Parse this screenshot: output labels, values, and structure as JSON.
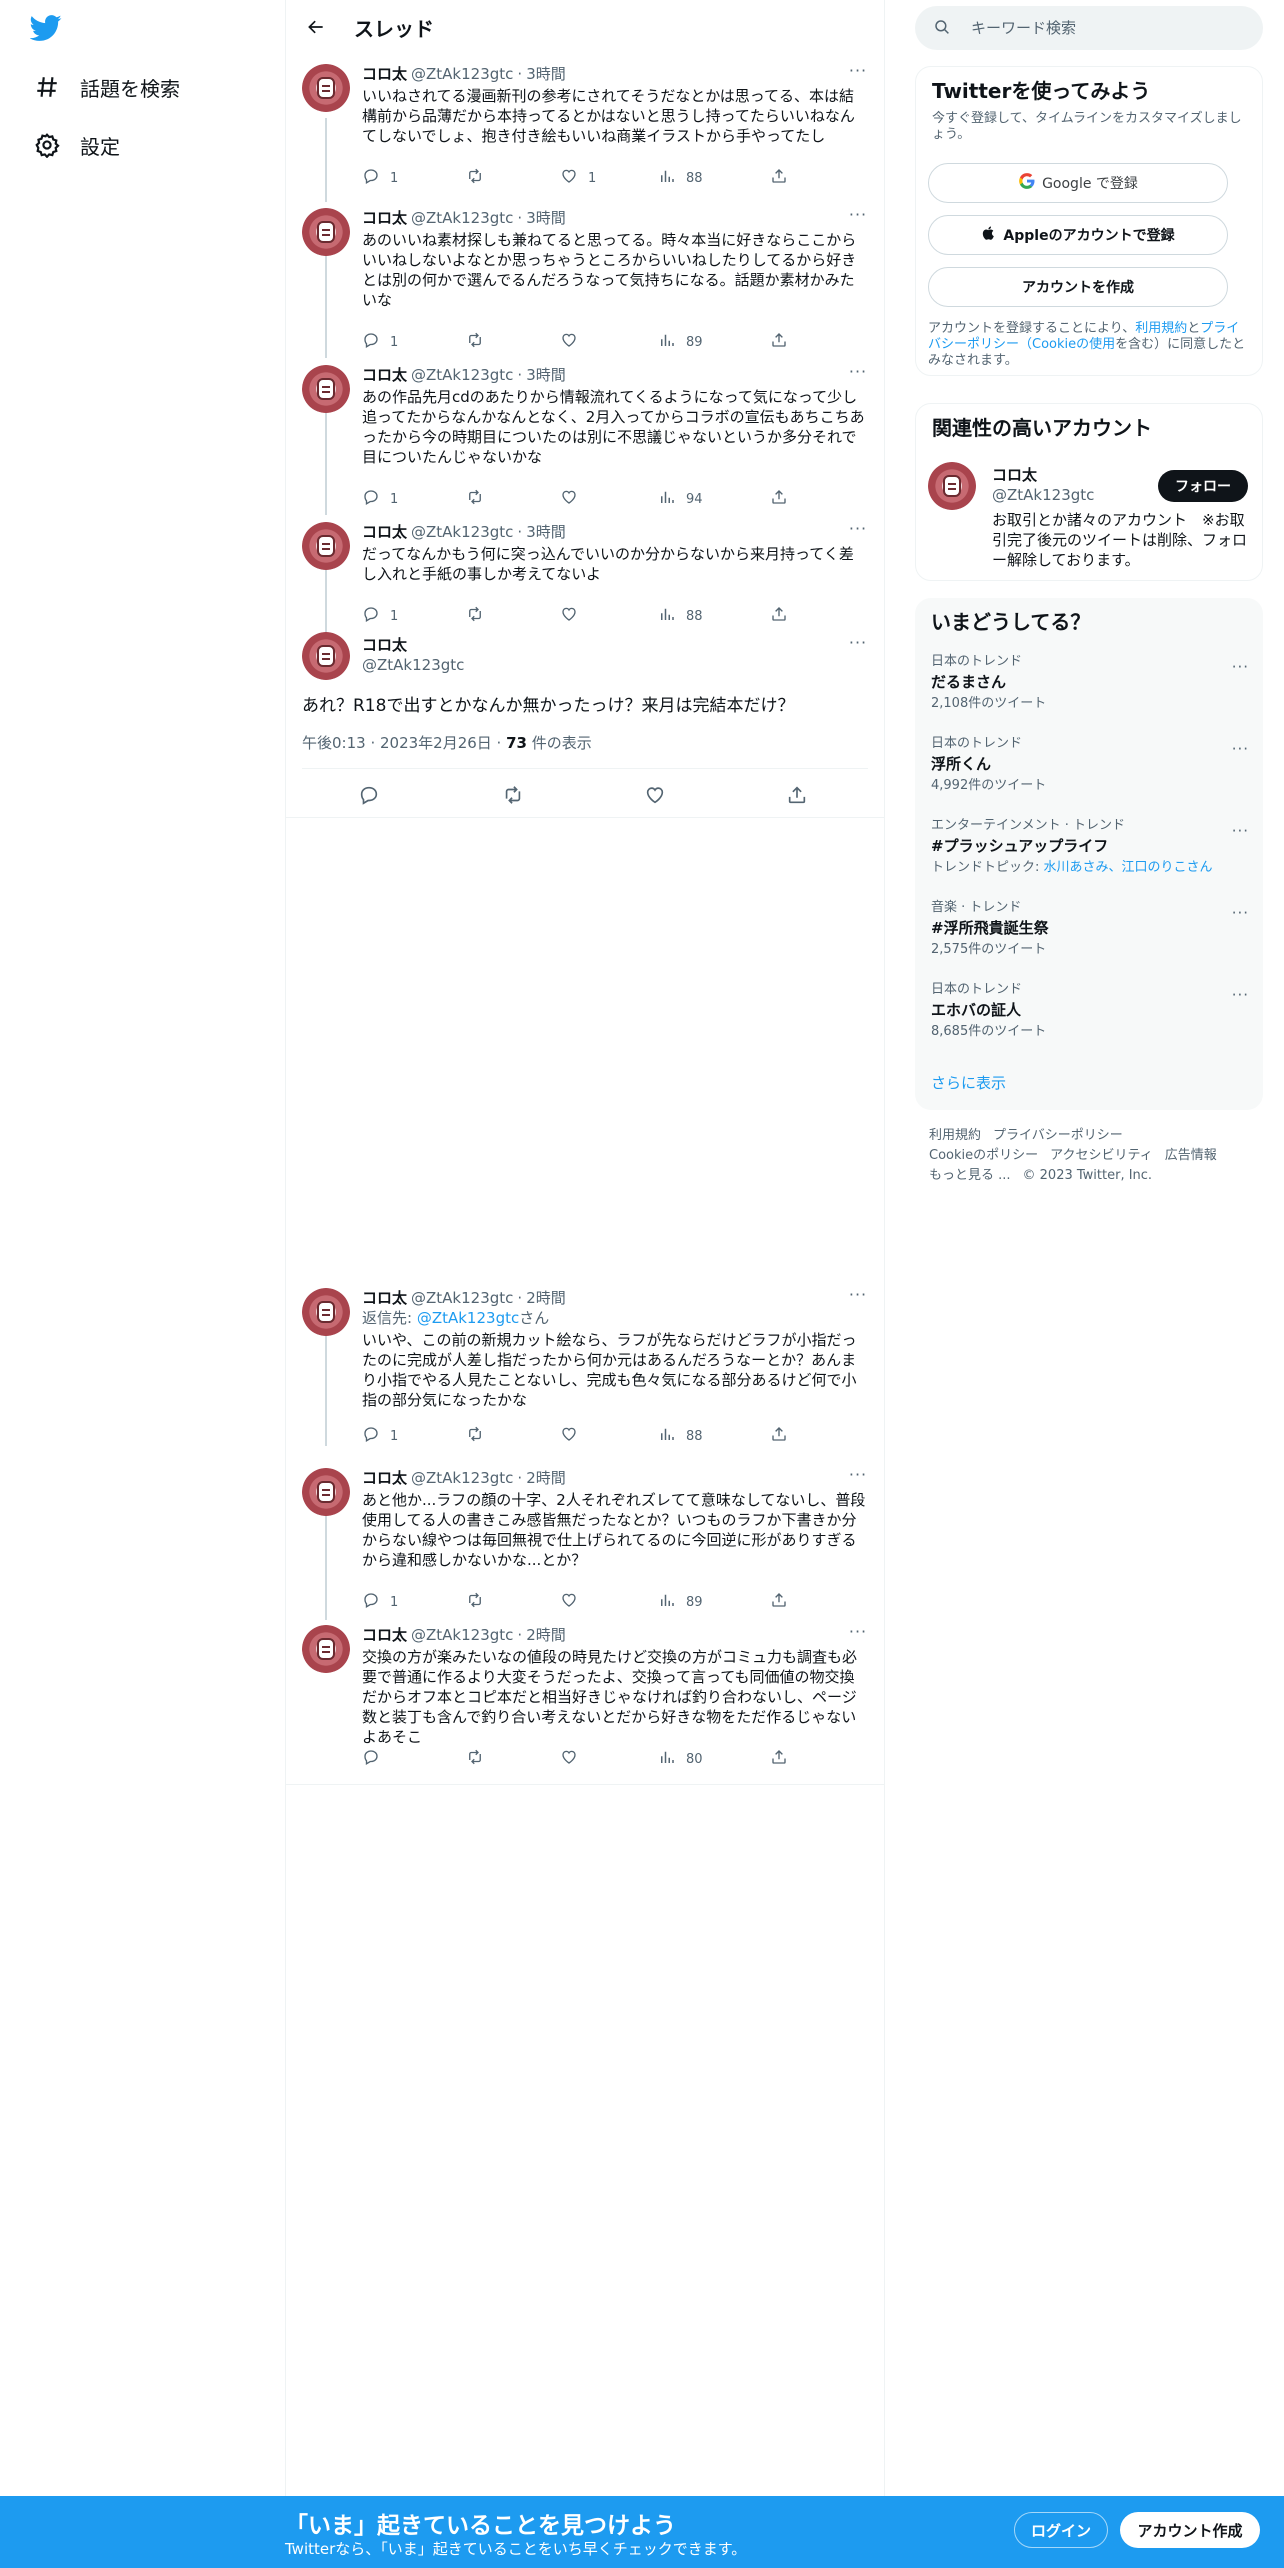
{
  "nav": {
    "explore_label": "話題を検索",
    "settings_label": "設定"
  },
  "header": {
    "title": "スレッド"
  },
  "tweets_before": [
    {
      "name": "コロ太",
      "handle": "@ZtAk123gtc",
      "dot": "·",
      "time": "3時間",
      "text": "いいねされてる漫画新刊の参考にされてそうだなとかは思ってる、本は結構前から品薄だから本持ってるとかはないと思うし持ってたらいいねなんてしないでしょ、抱き付き絵もいいね商業イラストから手やってたし",
      "reply": "1",
      "rt": "",
      "like": "1",
      "views": "88"
    },
    {
      "name": "コロ太",
      "handle": "@ZtAk123gtc",
      "dot": "·",
      "time": "3時間",
      "text": "あのいいね素材探しも兼ねてると思ってる。時々本当に好きならここからいいねしないよなとか思っちゃうところからいいねしたりしてるから好きとは別の何かで選んでるんだろうなって気持ちになる。話題か素材かみたいな",
      "reply": "1",
      "rt": "",
      "like": "",
      "views": "89"
    },
    {
      "name": "コロ太",
      "handle": "@ZtAk123gtc",
      "dot": "·",
      "time": "3時間",
      "text": "あの作品先月cdのあたりから情報流れてくるようになって気になって少し追ってたからなんかなんとなく、2月入ってからコラボの宣伝もあちこちあったから今の時期目についたのは別に不思議じゃないというか多分それで目についたんじゃないかな",
      "reply": "1",
      "rt": "",
      "like": "",
      "views": "94"
    },
    {
      "name": "コロ太",
      "handle": "@ZtAk123gtc",
      "dot": "·",
      "time": "3時間",
      "text": "だってなんかもう何に突っ込んでいいのか分からないから来月持ってく差し入れと手紙の事しか考えてないよ",
      "reply": "1",
      "rt": "",
      "like": "",
      "views": "88"
    }
  ],
  "main_tweet": {
    "name": "コロ太",
    "handle": "@ZtAk123gtc",
    "text": "あれ？R18で出すとかなんか無かったっけ？来月は完結本だけ？",
    "timestamp": "午後0:13 · 2023年2月26日 · ",
    "views_count": "73",
    "views_label": " 件の表示"
  },
  "tweets_after": [
    {
      "name": "コロ太",
      "handle": "@ZtAk123gtc",
      "dot": "·",
      "time": "2時間",
      "reply_prefix": "返信先: ",
      "reply_to": "@ZtAk123gtc",
      "reply_suffix": "さん",
      "text": "いいや、この前の新規カット絵なら、ラフが先ならだけどラフが小指だったのに完成が人差し指だったから何か元はあるんだろうなーとか？あんまり小指でやる人見たことないし、完成も色々気になる部分あるけど何で小指の部分気になったかな",
      "reply": "1",
      "rt": "",
      "like": "",
      "views": "88"
    },
    {
      "name": "コロ太",
      "handle": "@ZtAk123gtc",
      "dot": "·",
      "time": "2時間",
      "text": "あと他か...ラフの顔の十字、2人それぞれズレてて意味なしてないし、普段使用してる人の書きこみ感皆無だったなとか？いつものラフか下書きか分からない線やつは毎回無視で仕上げられてるのに今回逆に形がありすぎるから違和感しかないかな...とか？",
      "reply": "1",
      "rt": "",
      "like": "",
      "views": "89"
    },
    {
      "name": "コロ太",
      "handle": "@ZtAk123gtc",
      "dot": "·",
      "time": "2時間",
      "text": "交換の方が楽みたいなの値段の時見たけど交換の方がコミュ力も調査も必要で普通に作るより大変そうだったよ、交換って言っても同価値の物交換だからオフ本とコピ本だと相当好きじゃなければ釣り合わないし、ページ数と装丁も含んで釣り合い考えないとだから好きな物をただ作るじゃないよあそこ",
      "reply": "",
      "rt": "",
      "like": "",
      "views": "80"
    }
  ],
  "search": {
    "placeholder": "キーワード検索"
  },
  "signup": {
    "title": "Twitterを使ってみよう",
    "subtitle": "今すぐ登録して、タイムラインをカスタマイズしましょう。",
    "google_label": "Google で登録",
    "apple_label": "Appleのアカウントで登録",
    "create_label": "アカウントを作成",
    "legal_1": "アカウントを登録することにより、",
    "legal_terms": "利用規約",
    "legal_2": "と",
    "legal_privacy": "プライバシーポリシー（Cookieの使用",
    "legal_3": "を含む）に同意したとみなされます。"
  },
  "related": {
    "title": "関連性の高いアカウント",
    "name": "コロ太",
    "handle": "@ZtAk123gtc",
    "follow_label": "フォロー",
    "bio": "お取引とか諸々のアカウント　※お取引完了後元のツイートは削除、フォロー解除しております。"
  },
  "trends": {
    "title": "いまどうしてる？",
    "items": [
      {
        "context": "日本のトレンド",
        "title": "だるまさん",
        "count": "2,108件のツイート"
      },
      {
        "context": "日本のトレンド",
        "title": "浮所くん",
        "count": "4,992件のツイート"
      },
      {
        "context": "エンターテインメント · トレンド",
        "title": "#プラッシュアップライフ",
        "count_prefix": "トレンドトピック: ",
        "count_link": "水川あさみ、江口のりこさん"
      },
      {
        "context": "音楽 · トレンド",
        "title": "#浮所飛貴誕生祭",
        "count": "2,575件のツイート"
      },
      {
        "context": "日本のトレンド",
        "title": "エホバの証人",
        "count": "8,685件のツイート"
      }
    ],
    "show_more": "さらに表示"
  },
  "footer": {
    "terms": "利用規約",
    "privacy": "プライバシーポリシー",
    "cookie": "Cookieのポリシー",
    "accessibility": "アクセシビリティ",
    "ads": "広告情報",
    "more": "もっと見る ...",
    "copyright": "© 2023 Twitter, Inc."
  },
  "bottom_bar": {
    "title": "「いま」起きていることを見つけよう",
    "subtitle": "Twitterなら、「いま」起きていることをいち早くチェックできます。",
    "login_label": "ログイン",
    "signup_label": "アカウント作成"
  },
  "colors": {
    "accent": "#1d9bf0",
    "text": "#0f1419",
    "muted": "#536471"
  }
}
